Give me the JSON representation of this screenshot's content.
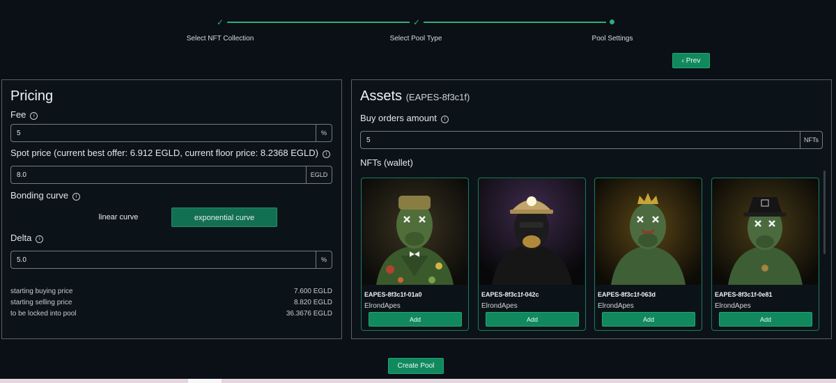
{
  "stepper": {
    "steps": [
      {
        "label": "Select NFT Collection",
        "status": "done"
      },
      {
        "label": "Select Pool Type",
        "status": "done"
      },
      {
        "label": "Pool Settings",
        "status": "current"
      }
    ],
    "check_glyph": "✓",
    "prev_label": "‹ Prev"
  },
  "pricing": {
    "title": "Pricing",
    "fee_label": "Fee",
    "fee_value": "5",
    "fee_unit": "%",
    "spot_label": "Spot price (current best offer: 6.912 EGLD, current floor price: 8.2368 EGLD)",
    "spot_value": "8.0",
    "spot_unit": "EGLD",
    "curve_label": "Bonding curve",
    "curve_options": [
      "linear curve",
      "exponential curve"
    ],
    "curve_selected": "exponential curve",
    "delta_label": "Delta",
    "delta_value": "5.0",
    "delta_unit": "%",
    "summary": [
      {
        "label": "starting buying price",
        "value": "7.600 EGLD"
      },
      {
        "label": "starting selling price",
        "value": "8.820 EGLD"
      },
      {
        "label": "to be locked into pool",
        "value": "36.3676 EGLD"
      }
    ]
  },
  "assets": {
    "title": "Assets",
    "collection_id": "(EAPES-8f3c1f)",
    "buy_orders_label": "Buy orders amount",
    "buy_orders_value": "5",
    "buy_orders_unit": "NFTs",
    "nfts_label": "NFTs (wallet)",
    "cards": [
      {
        "name": "EAPES-8f3c1f-01a0",
        "collection": "ElrondApes",
        "add_label": "Add"
      },
      {
        "name": "EAPES-8f3c1f-042c",
        "collection": "ElrondApes",
        "add_label": "Add"
      },
      {
        "name": "EAPES-8f3c1f-063d",
        "collection": "ElrondApes",
        "add_label": "Add"
      },
      {
        "name": "EAPES-8f3c1f-0e81",
        "collection": "ElrondApes",
        "add_label": "Add"
      }
    ]
  },
  "create_pool_label": "Create Pool",
  "icons": {
    "info": "info-icon",
    "check": "check-icon",
    "chevron": "chevron-left-icon"
  },
  "colors": {
    "accent": "#12885e",
    "step": "#2fae77",
    "background": "#0a1015",
    "border": "#5a6064"
  }
}
